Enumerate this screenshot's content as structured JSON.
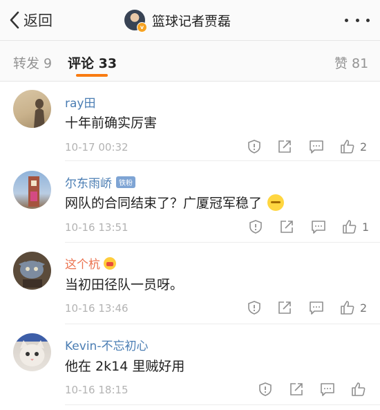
{
  "nav": {
    "back_label": "返回",
    "title": "篮球记者贾磊"
  },
  "tabs": {
    "repost": "转发 9",
    "comments": "评论 33",
    "likes": "赞 81"
  },
  "comments": [
    {
      "username": "ray田",
      "text": "十年前确实厉害",
      "time": "10-17 00:32",
      "likes": "2"
    },
    {
      "username": "尔东雨峤",
      "badge": "铁粉",
      "text": "网队的合同结束了？广厦冠军稳了",
      "time": "10-16 13:51",
      "likes": "1"
    },
    {
      "username": "这个杭",
      "text": "当初田径队一员呀。",
      "time": "10-16 13:46",
      "likes": "2"
    },
    {
      "username": "Kevin-不忘初心",
      "text": "他在 2k14 里贼好用",
      "time": "10-16 18:15",
      "likes": ""
    }
  ],
  "colors": {
    "accent": "#f97b11",
    "username_blue": "#4a7db3",
    "username_orange": "#eb7350",
    "icon_gray": "#8f8f8f"
  }
}
